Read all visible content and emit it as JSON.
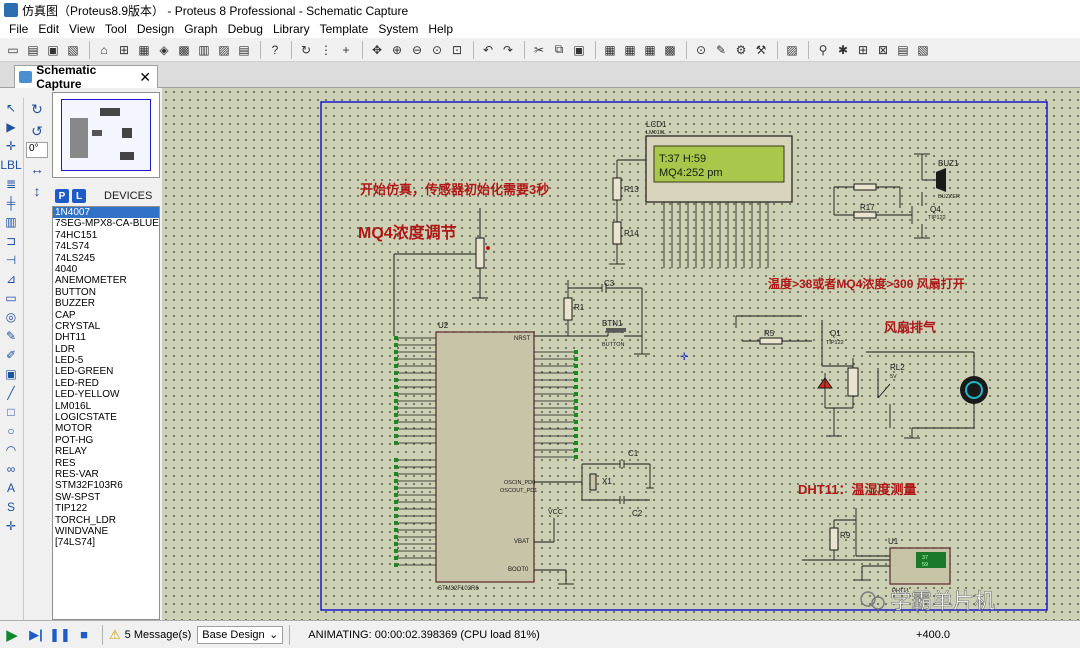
{
  "window": {
    "title": "仿真图（Proteus8.9版本） - Proteus 8 Professional - Schematic Capture"
  },
  "menu": [
    "File",
    "Edit",
    "View",
    "Tool",
    "Design",
    "Graph",
    "Debug",
    "Library",
    "Template",
    "System",
    "Help"
  ],
  "tab": {
    "label": "Schematic Capture",
    "close": "✕"
  },
  "rotation": {
    "angle": "0°"
  },
  "devices": {
    "header": "DEVICES",
    "p_label": "P",
    "l_label": "L",
    "selected": "1N4007",
    "items": [
      "1N4007",
      "7SEG-MPX8-CA-BLUE",
      "74HC151",
      "74LS74",
      "74LS245",
      "4040",
      "ANEMOMETER",
      "BUTTON",
      "BUZZER",
      "CAP",
      "CRYSTAL",
      "DHT11",
      "LDR",
      "LED-5",
      "LED-GREEN",
      "LED-RED",
      "LED-YELLOW",
      "LM016L",
      "LOGICSTATE",
      "MOTOR",
      "POT-HG",
      "RELAY",
      "RES",
      "RES-VAR",
      "STM32F103R6",
      "SW-SPST",
      "TIP122",
      "TORCH_LDR",
      "WINDVANE",
      "[74LS74]"
    ]
  },
  "schematic": {
    "annotations": {
      "start_note": "开始仿真，传感器初始化需要3秒",
      "mq4_adjust": "MQ4浓度调节",
      "fan_condition": "温度>38或者MQ4浓度>300  风扇打开",
      "fan_exhaust": "风扇排气",
      "dht11_label": "DHT11：温湿度测量"
    },
    "lcd": {
      "ref": "LCD1",
      "model": "LM016L",
      "line1": "T:37    H:59",
      "line2": " MQ4:252  pm"
    },
    "mcu": {
      "ref": "U2",
      "model": "STM32F103R6",
      "pin_nrst": "NRST",
      "pin_vbat": "VBAT",
      "pin_boot0": "BOOT0",
      "pin_osc_in": "OSCIN_PD0",
      "pin_osc_out": "OSCOUT_PD1"
    },
    "components": {
      "r13": "R13",
      "r14": "R14",
      "r1": "R1",
      "r5": "R5",
      "r9": "R9",
      "r17": "R17",
      "c3": "C3",
      "c1": "C1",
      "c2": "C2",
      "x1": "X1",
      "btn1": "BTN1",
      "btn1_model": "BUTTON",
      "buz1": "BUZ1",
      "buz1_model": "BUZZER",
      "q1": "Q1",
      "q1_model": "TIP122",
      "q4": "Q4",
      "q4_model": "TIP122",
      "rl2": "RL2",
      "rl2_val": "5V",
      "u1": "U1",
      "u1_model": "DHT11",
      "vcc": "VCC",
      "dht_display_temp": "37",
      "dht_display_hum": "59"
    },
    "watermark": "学霸单片机"
  },
  "status": {
    "messages": "5 Message(s)",
    "design_mode": "Base Design",
    "animating": "ANIMATING: 00:00:02.398369 (CPU load 81%)",
    "coordinate": "+400.0"
  },
  "colors": {
    "canvas_bg": "#ccd0b4",
    "wire": "#1a1a1a",
    "annotation_red": "#b01818",
    "lcd_bg": "#a7c84a",
    "chip_fill": "#c8c4a8",
    "sheet_border": "#1a1ad0"
  }
}
